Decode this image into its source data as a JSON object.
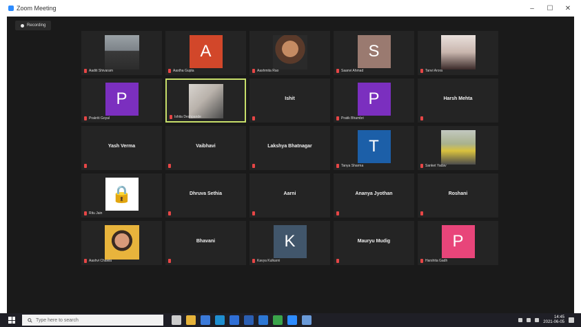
{
  "window": {
    "title": "Zoom Meeting",
    "controls": [
      "–",
      "☐",
      "✕"
    ]
  },
  "recording": {
    "label": "Recording"
  },
  "participants": [
    {
      "name": "Aaditi Shivaram",
      "kind": "photo",
      "photo": "man"
    },
    {
      "name": "Aastha Gupta",
      "kind": "avatar",
      "initial": "A",
      "color": "#d2472a"
    },
    {
      "name": "Aashmita Rao",
      "kind": "photo",
      "photo": "woman"
    },
    {
      "name": "Saanvi Ahmad",
      "kind": "avatar",
      "initial": "S",
      "color": "#9a7a70"
    },
    {
      "name": "Tanvi Arora",
      "kind": "photo",
      "photo": "girl"
    },
    {
      "name": "Prakriti Goyal",
      "kind": "avatar",
      "initial": "P",
      "color": "#7b2fbf"
    },
    {
      "name": "Ishita Deshpande",
      "kind": "photo",
      "photo": "room",
      "active": true
    },
    {
      "name": "Ishit",
      "kind": "name"
    },
    {
      "name": "Pratik Bhambri",
      "kind": "avatar",
      "initial": "P",
      "color": "#7b2fbf"
    },
    {
      "name": "Harsh Mehta",
      "kind": "name"
    },
    {
      "name": "Yash Verma",
      "kind": "name"
    },
    {
      "name": "Vaibhavi",
      "kind": "name"
    },
    {
      "name": "Lakshya Bhatnagar",
      "kind": "name"
    },
    {
      "name": "Tanya Sharma",
      "kind": "avatar",
      "initial": "T",
      "color": "#1c5fa8"
    },
    {
      "name": "Sanket Yadav",
      "kind": "photo",
      "photo": "man2"
    },
    {
      "name": "Ritu Jain",
      "kind": "avatar",
      "initial": "🔒",
      "color": "#ffffff"
    },
    {
      "name": "Dhruva Sethia",
      "kind": "name"
    },
    {
      "name": "Aarni",
      "kind": "name"
    },
    {
      "name": "Ananya Jyothan",
      "kind": "name"
    },
    {
      "name": "Roshani",
      "kind": "name"
    },
    {
      "name": "Aashvi Chawla",
      "kind": "photo",
      "photo": "smile"
    },
    {
      "name": "Bhavani",
      "kind": "name"
    },
    {
      "name": "Kavya Kulkarni",
      "kind": "avatar",
      "initial": "K",
      "color": "#41566b"
    },
    {
      "name": "Mauryu Mudig",
      "kind": "name"
    },
    {
      "name": "Harshita Gadh",
      "kind": "avatar",
      "initial": "P",
      "color": "#e8457a"
    }
  ],
  "taskbar": {
    "search_placeholder": "Type here to search",
    "apps": [
      {
        "name": "task-view",
        "color": "#cccccc"
      },
      {
        "name": "file-explorer",
        "color": "#e6b33a"
      },
      {
        "name": "store",
        "color": "#3b7ad9"
      },
      {
        "name": "edge",
        "color": "#1f8fd1"
      },
      {
        "name": "mail",
        "color": "#2f6fd6"
      },
      {
        "name": "word",
        "color": "#2b5fb3"
      },
      {
        "name": "photos",
        "color": "#2c77d4"
      },
      {
        "name": "chrome",
        "color": "#3aa44a"
      },
      {
        "name": "zoom",
        "color": "#2d8cff"
      },
      {
        "name": "meet",
        "color": "#6a9ad8"
      }
    ],
    "clock_time": "14:45",
    "clock_date": "2021-06-05"
  }
}
